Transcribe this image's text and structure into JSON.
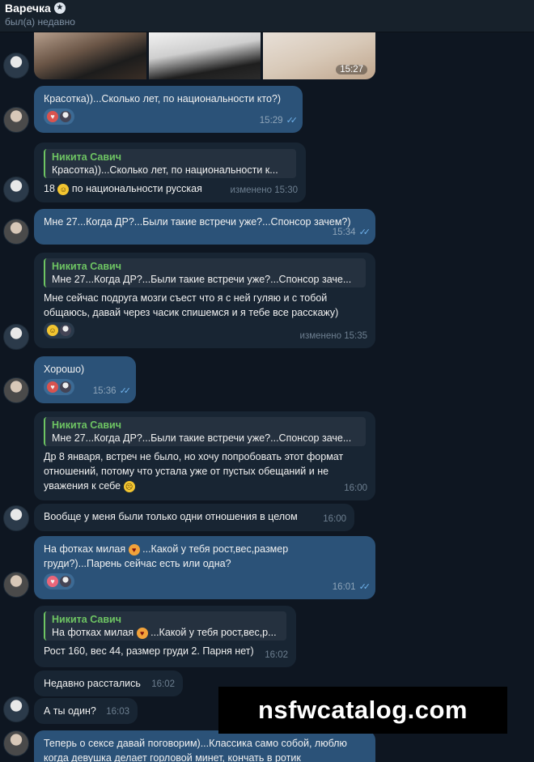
{
  "header": {
    "name": "Варечка",
    "star_icon": "star-badge-icon",
    "status": "был(а) недавно"
  },
  "photos": {
    "time": "15:27"
  },
  "messages": [
    {
      "text": "Красотка))...Сколько лет, по национальности кто?)",
      "time": "15:29",
      "reactions": [
        "red-heart-emoji",
        "avatar"
      ]
    },
    {
      "quote_name": "Никита Савич",
      "quote_text": "Красотка))...Сколько лет, по национальности к...",
      "text_a": "18",
      "text_b": "по национальности русская",
      "time": "изменено 15:30"
    },
    {
      "text": "Мне 27...Когда ДР?...Были такие встречи уже?...Спонсор зачем?)",
      "time": "15:34"
    },
    {
      "quote_name": "Никита Савич",
      "quote_text": "Мне 27...Когда ДР?...Были такие встречи уже?...Спонсор заче...",
      "text": "Мне сейчас подруга  мозги съест что я с ней гуляю и с тобой общаюсь, давай через часик спишемся и я тебе все расскажу)",
      "time": "изменено 15:35"
    },
    {
      "text": "Хорошо)",
      "time": "15:36"
    },
    {
      "quote_name": "Никита Савич",
      "quote_text": "Мне 27...Когда ДР?...Были такие встречи уже?...Спонсор заче...",
      "text": "Др 8 января, встреч не было, но хочу попробовать этот формат отношений, потому что устала уже от пустых обещаний и не уважения к себе",
      "time": "16:00"
    },
    {
      "text": "Вообще у меня были только одни отношения в целом",
      "time": "16:00"
    },
    {
      "text_a": "На фотках милая",
      "text_b": "...Какой у тебя рост,вес,размер груди?)...Парень сейчас есть или одна?",
      "time": "16:01"
    },
    {
      "quote_name": "Никита Савич",
      "quote_text": "На фотках милая",
      "quote_text_b": "...Какой у тебя рост,вес,р...",
      "text": "Рост 160, вес 44, размер груди 2. Парня нет)",
      "time": "16:02"
    },
    {
      "text": "Недавно расстались",
      "time": "16:02"
    },
    {
      "text": "А ты один?",
      "time": "16:03"
    },
    {
      "text": "Теперь о сексе давай поговорим)...Классика само собой, люблю когда девушка делает горловой минет, кончать в ротик"
    }
  ],
  "watermark": "nsfwcatalog.com",
  "colors": {
    "background": "#0e1621",
    "outgoing": "#2b5278",
    "incoming": "#182533",
    "quote_accent": "#6ec563"
  }
}
